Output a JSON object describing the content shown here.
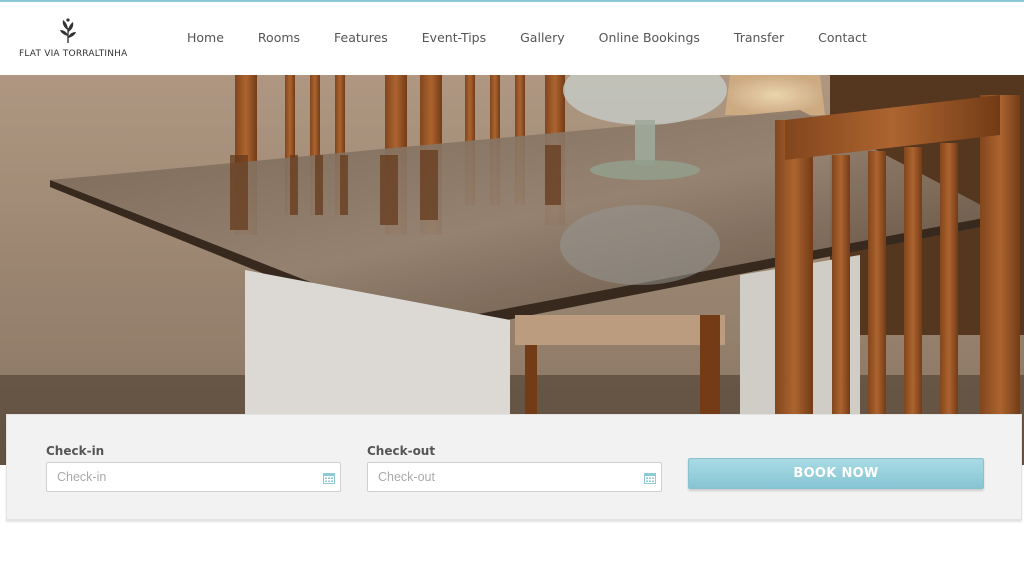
{
  "brand": {
    "name": "FLAT VIA TORRALTINHA",
    "logo_icon": "plant-sprig-icon"
  },
  "nav": {
    "items": [
      {
        "label": "Home"
      },
      {
        "label": "Rooms"
      },
      {
        "label": "Features"
      },
      {
        "label": "Event-Tips"
      },
      {
        "label": "Gallery"
      },
      {
        "label": "Online Bookings"
      },
      {
        "label": "Transfer"
      },
      {
        "label": "Contact"
      }
    ]
  },
  "hero": {
    "image": "dining-table-with-chairs-photo"
  },
  "booking": {
    "checkin_label": "Check-in",
    "checkin_placeholder": "Check-in",
    "checkout_label": "Check-out",
    "checkout_placeholder": "Check-out",
    "calendar_icon": "calendar-icon",
    "button_label": "BOOK NOW"
  },
  "colors": {
    "accent": "#8ccad6",
    "button": "#94cfdb"
  }
}
